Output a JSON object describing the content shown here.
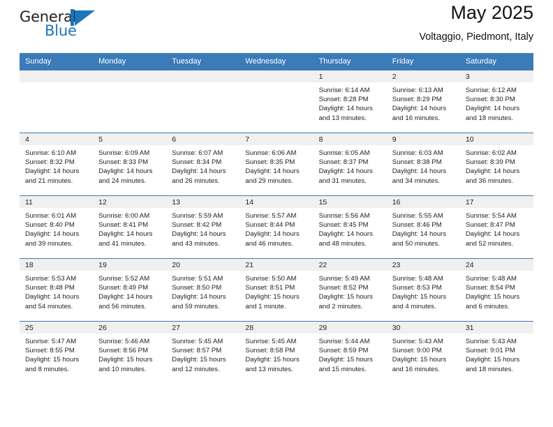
{
  "brand": {
    "name_part1": "General",
    "name_part2": "Blue",
    "accent_color": "#1b75bb"
  },
  "header": {
    "title": "May 2025",
    "subtitle": "Voltaggio, Piedmont, Italy"
  },
  "calendar": {
    "header_color": "#3b7cb8",
    "weekdays": [
      "Sunday",
      "Monday",
      "Tuesday",
      "Wednesday",
      "Thursday",
      "Friday",
      "Saturday"
    ],
    "weeks": [
      [
        {
          "day": "",
          "lines": []
        },
        {
          "day": "",
          "lines": []
        },
        {
          "day": "",
          "lines": []
        },
        {
          "day": "",
          "lines": []
        },
        {
          "day": "1",
          "lines": [
            "Sunrise: 6:14 AM",
            "Sunset: 8:28 PM",
            "Daylight: 14 hours",
            "and 13 minutes."
          ]
        },
        {
          "day": "2",
          "lines": [
            "Sunrise: 6:13 AM",
            "Sunset: 8:29 PM",
            "Daylight: 14 hours",
            "and 16 minutes."
          ]
        },
        {
          "day": "3",
          "lines": [
            "Sunrise: 6:12 AM",
            "Sunset: 8:30 PM",
            "Daylight: 14 hours",
            "and 18 minutes."
          ]
        }
      ],
      [
        {
          "day": "4",
          "lines": [
            "Sunrise: 6:10 AM",
            "Sunset: 8:32 PM",
            "Daylight: 14 hours",
            "and 21 minutes."
          ]
        },
        {
          "day": "5",
          "lines": [
            "Sunrise: 6:09 AM",
            "Sunset: 8:33 PM",
            "Daylight: 14 hours",
            "and 24 minutes."
          ]
        },
        {
          "day": "6",
          "lines": [
            "Sunrise: 6:07 AM",
            "Sunset: 8:34 PM",
            "Daylight: 14 hours",
            "and 26 minutes."
          ]
        },
        {
          "day": "7",
          "lines": [
            "Sunrise: 6:06 AM",
            "Sunset: 8:35 PM",
            "Daylight: 14 hours",
            "and 29 minutes."
          ]
        },
        {
          "day": "8",
          "lines": [
            "Sunrise: 6:05 AM",
            "Sunset: 8:37 PM",
            "Daylight: 14 hours",
            "and 31 minutes."
          ]
        },
        {
          "day": "9",
          "lines": [
            "Sunrise: 6:03 AM",
            "Sunset: 8:38 PM",
            "Daylight: 14 hours",
            "and 34 minutes."
          ]
        },
        {
          "day": "10",
          "lines": [
            "Sunrise: 6:02 AM",
            "Sunset: 8:39 PM",
            "Daylight: 14 hours",
            "and 36 minutes."
          ]
        }
      ],
      [
        {
          "day": "11",
          "lines": [
            "Sunrise: 6:01 AM",
            "Sunset: 8:40 PM",
            "Daylight: 14 hours",
            "and 39 minutes."
          ]
        },
        {
          "day": "12",
          "lines": [
            "Sunrise: 6:00 AM",
            "Sunset: 8:41 PM",
            "Daylight: 14 hours",
            "and 41 minutes."
          ]
        },
        {
          "day": "13",
          "lines": [
            "Sunrise: 5:59 AM",
            "Sunset: 8:42 PM",
            "Daylight: 14 hours",
            "and 43 minutes."
          ]
        },
        {
          "day": "14",
          "lines": [
            "Sunrise: 5:57 AM",
            "Sunset: 8:44 PM",
            "Daylight: 14 hours",
            "and 46 minutes."
          ]
        },
        {
          "day": "15",
          "lines": [
            "Sunrise: 5:56 AM",
            "Sunset: 8:45 PM",
            "Daylight: 14 hours",
            "and 48 minutes."
          ]
        },
        {
          "day": "16",
          "lines": [
            "Sunrise: 5:55 AM",
            "Sunset: 8:46 PM",
            "Daylight: 14 hours",
            "and 50 minutes."
          ]
        },
        {
          "day": "17",
          "lines": [
            "Sunrise: 5:54 AM",
            "Sunset: 8:47 PM",
            "Daylight: 14 hours",
            "and 52 minutes."
          ]
        }
      ],
      [
        {
          "day": "18",
          "lines": [
            "Sunrise: 5:53 AM",
            "Sunset: 8:48 PM",
            "Daylight: 14 hours",
            "and 54 minutes."
          ]
        },
        {
          "day": "19",
          "lines": [
            "Sunrise: 5:52 AM",
            "Sunset: 8:49 PM",
            "Daylight: 14 hours",
            "and 56 minutes."
          ]
        },
        {
          "day": "20",
          "lines": [
            "Sunrise: 5:51 AM",
            "Sunset: 8:50 PM",
            "Daylight: 14 hours",
            "and 59 minutes."
          ]
        },
        {
          "day": "21",
          "lines": [
            "Sunrise: 5:50 AM",
            "Sunset: 8:51 PM",
            "Daylight: 15 hours",
            "and 1 minute."
          ]
        },
        {
          "day": "22",
          "lines": [
            "Sunrise: 5:49 AM",
            "Sunset: 8:52 PM",
            "Daylight: 15 hours",
            "and 2 minutes."
          ]
        },
        {
          "day": "23",
          "lines": [
            "Sunrise: 5:48 AM",
            "Sunset: 8:53 PM",
            "Daylight: 15 hours",
            "and 4 minutes."
          ]
        },
        {
          "day": "24",
          "lines": [
            "Sunrise: 5:48 AM",
            "Sunset: 8:54 PM",
            "Daylight: 15 hours",
            "and 6 minutes."
          ]
        }
      ],
      [
        {
          "day": "25",
          "lines": [
            "Sunrise: 5:47 AM",
            "Sunset: 8:55 PM",
            "Daylight: 15 hours",
            "and 8 minutes."
          ]
        },
        {
          "day": "26",
          "lines": [
            "Sunrise: 5:46 AM",
            "Sunset: 8:56 PM",
            "Daylight: 15 hours",
            "and 10 minutes."
          ]
        },
        {
          "day": "27",
          "lines": [
            "Sunrise: 5:45 AM",
            "Sunset: 8:57 PM",
            "Daylight: 15 hours",
            "and 12 minutes."
          ]
        },
        {
          "day": "28",
          "lines": [
            "Sunrise: 5:45 AM",
            "Sunset: 8:58 PM",
            "Daylight: 15 hours",
            "and 13 minutes."
          ]
        },
        {
          "day": "29",
          "lines": [
            "Sunrise: 5:44 AM",
            "Sunset: 8:59 PM",
            "Daylight: 15 hours",
            "and 15 minutes."
          ]
        },
        {
          "day": "30",
          "lines": [
            "Sunrise: 5:43 AM",
            "Sunset: 9:00 PM",
            "Daylight: 15 hours",
            "and 16 minutes."
          ]
        },
        {
          "day": "31",
          "lines": [
            "Sunrise: 5:43 AM",
            "Sunset: 9:01 PM",
            "Daylight: 15 hours",
            "and 18 minutes."
          ]
        }
      ]
    ]
  }
}
